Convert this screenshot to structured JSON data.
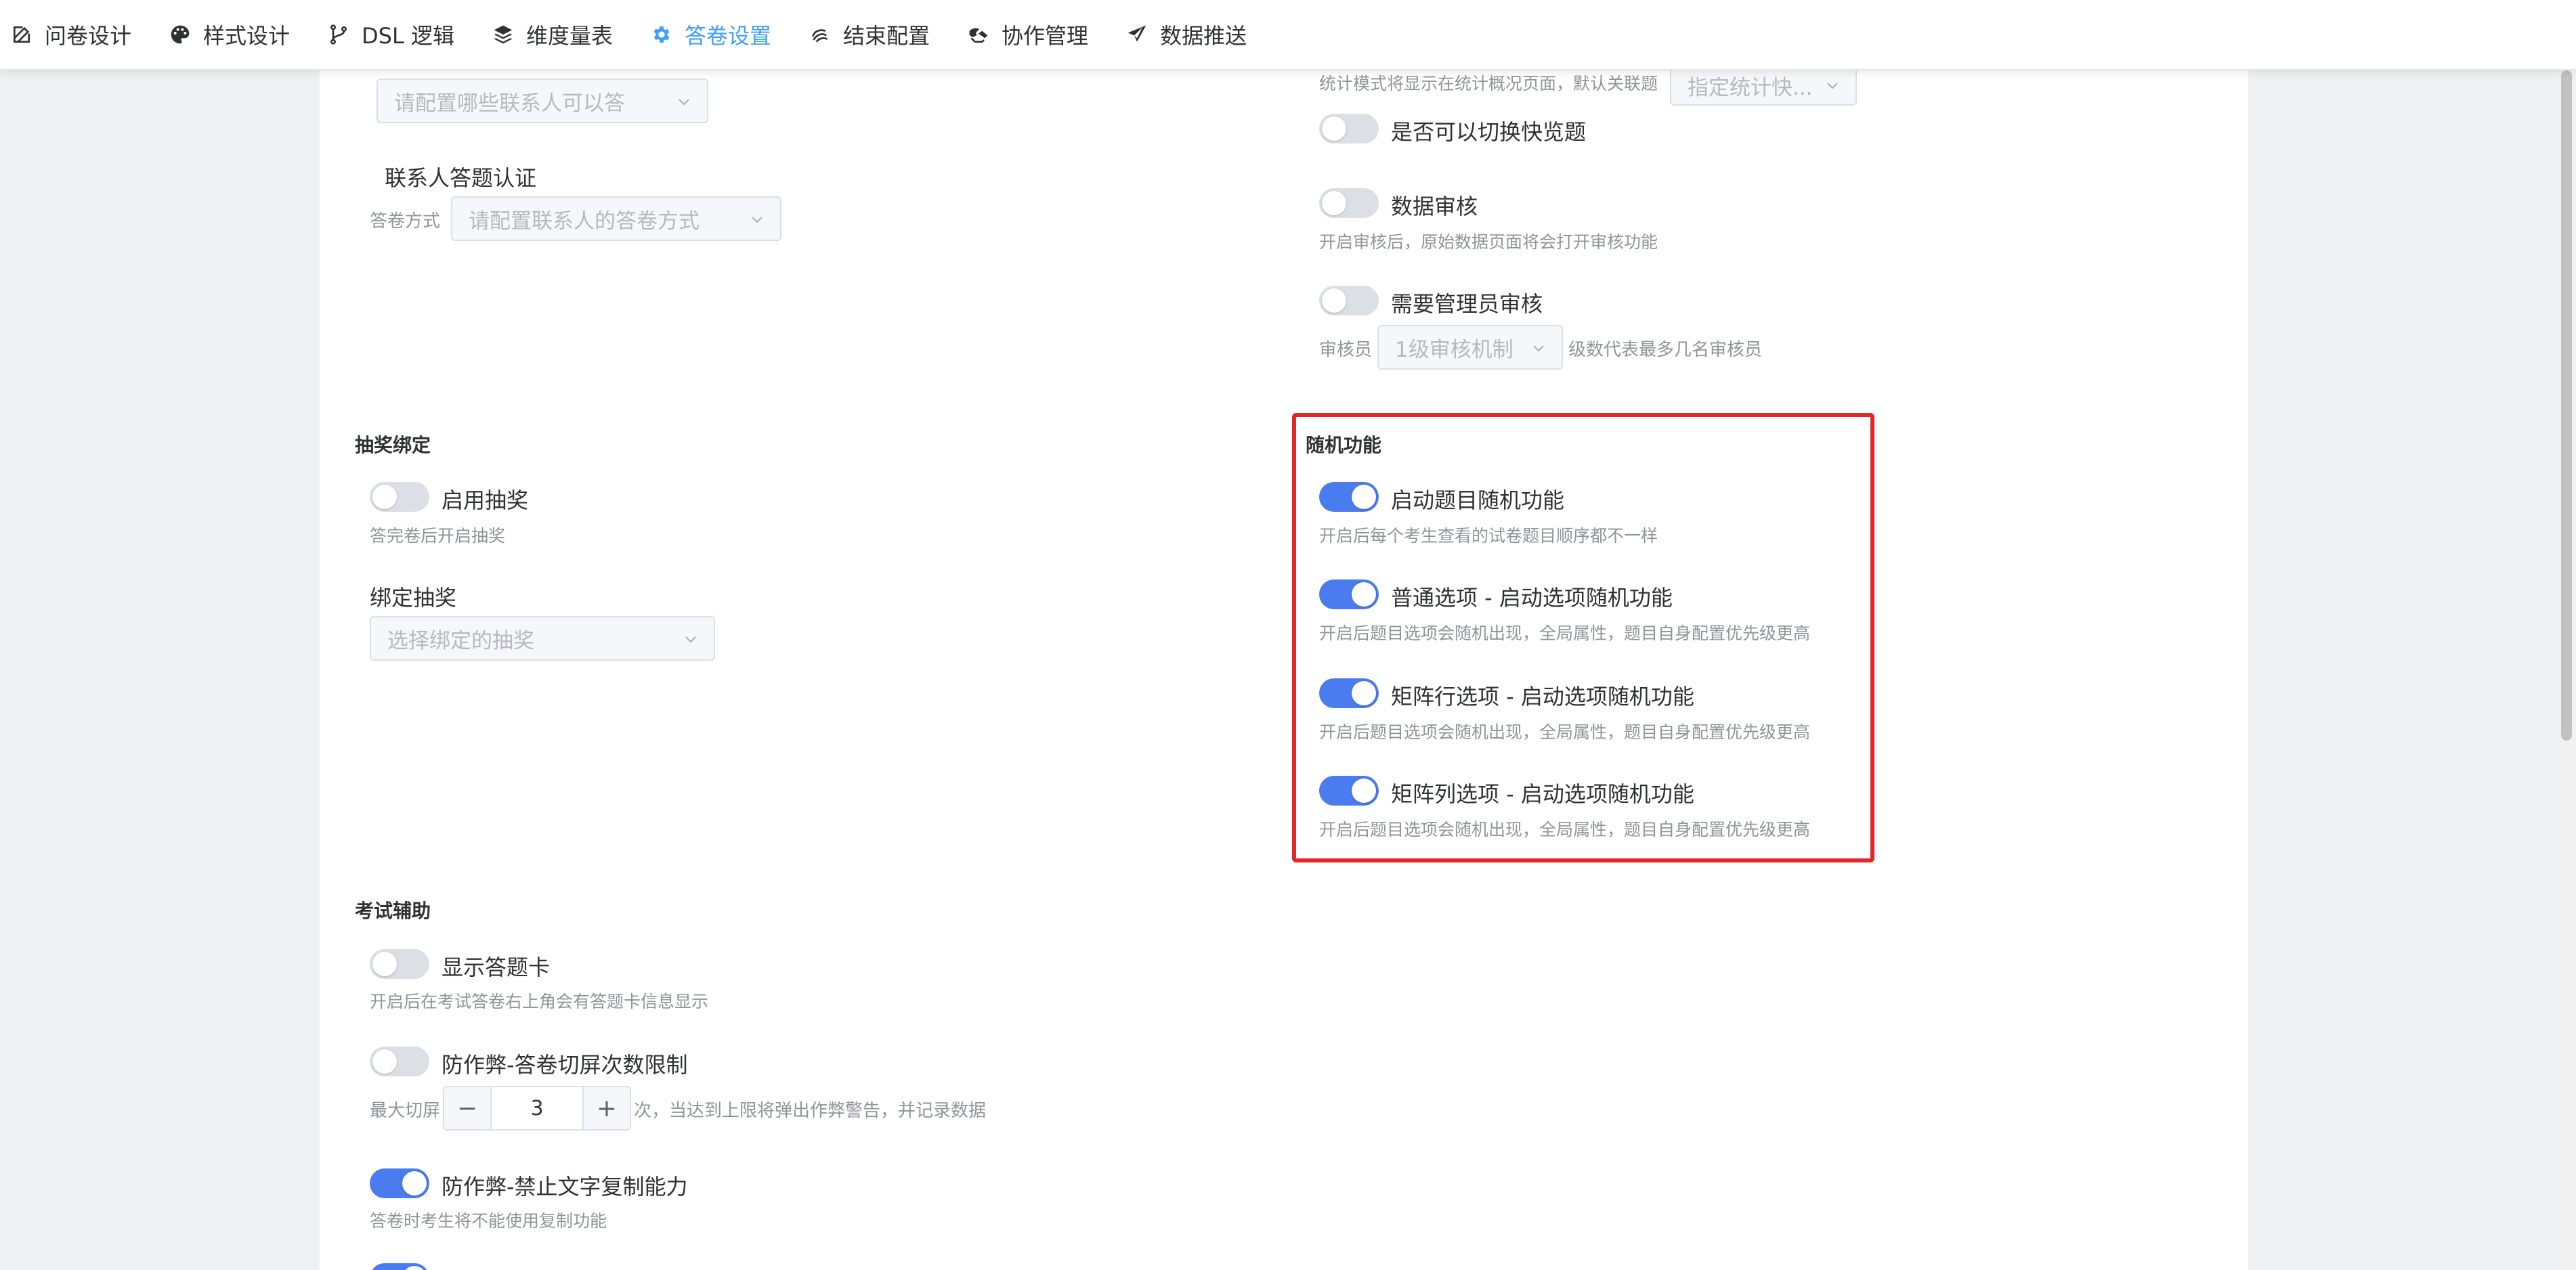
{
  "nav": {
    "tabs": [
      {
        "label": "问卷设计",
        "icon": "edit-icon",
        "active": false
      },
      {
        "label": "样式设计",
        "icon": "palette-icon",
        "active": false
      },
      {
        "label": "DSL 逻辑",
        "icon": "branch-icon",
        "active": false
      },
      {
        "label": "维度量表",
        "icon": "layers-icon",
        "active": false
      },
      {
        "label": "答卷设置",
        "icon": "gear-icon",
        "active": true
      },
      {
        "label": "结束配置",
        "icon": "spiral-icon",
        "active": false
      },
      {
        "label": "协作管理",
        "icon": "handshake-icon",
        "active": false
      },
      {
        "label": "数据推送",
        "icon": "send-icon",
        "active": false
      }
    ],
    "active_color": "#409eff"
  },
  "left": {
    "contacts_select_placeholder": "请配置哪些联系人可以答",
    "contact_auth": {
      "title": "联系人答题认证",
      "method_label": "答卷方式",
      "method_placeholder": "请配置联系人的答卷方式"
    },
    "lottery": {
      "section_title": "抽奖绑定",
      "enable_label": "启用抽奖",
      "enable_desc": "答完卷后开启抽奖",
      "enabled": false,
      "bind_title": "绑定抽奖",
      "bind_placeholder": "选择绑定的抽奖"
    },
    "exam": {
      "section_title": "考试辅助",
      "answer_card_label": "显示答题卡",
      "answer_card_desc": "开启后在考试答卷右上角会有答题卡信息显示",
      "answer_card_on": false,
      "switch_limit_label": "防作弊-答卷切屏次数限制",
      "switch_limit_on": false,
      "max_switch_prefix": "最大切屏",
      "max_switch_value": "3",
      "max_switch_suffix": "次，当达到上限将弹出作弊警告，并记录数据",
      "no_copy_label": "防作弊-禁止文字复制能力",
      "no_copy_desc": "答卷时考生将不能使用复制功能",
      "no_copy_on": true
    }
  },
  "right": {
    "stats_cut_text": "统计模式将显示在统计概况页面，默认关联题",
    "stats_select_placeholder": "指定统计快...",
    "quick_switch_label": "是否可以切换快览题",
    "quick_switch_on": false,
    "data_review_label": "数据审核",
    "data_review_desc": "开启审核后，原始数据页面将会打开审核功能",
    "data_review_on": false,
    "admin_review_label": "需要管理员审核",
    "admin_review_on": false,
    "reviewer_label": "审核员",
    "reviewer_select": "1级审核机制",
    "reviewer_suffix": "级数代表最多几名审核员",
    "random": {
      "section_title": "随机功能",
      "items": [
        {
          "label": "启动题目随机功能",
          "desc": "开启后每个考生查看的试卷题目顺序都不一样",
          "on": true
        },
        {
          "label": "普通选项 - 启动选项随机功能",
          "desc": "开启后题目选项会随机出现，全局属性，题目自身配置优先级更高",
          "on": true
        },
        {
          "label": "矩阵行选项 - 启动选项随机功能",
          "desc": "开启后题目选项会随机出现，全局属性，题目自身配置优先级更高",
          "on": true
        },
        {
          "label": "矩阵列选项 - 启动选项随机功能",
          "desc": "开启后题目选项会随机出现，全局属性，题目自身配置优先级更高",
          "on": true
        }
      ]
    }
  },
  "colors": {
    "switch_on": "#4a7cf0",
    "switch_off": "#dcdfe6",
    "highlight": "#e32626"
  }
}
